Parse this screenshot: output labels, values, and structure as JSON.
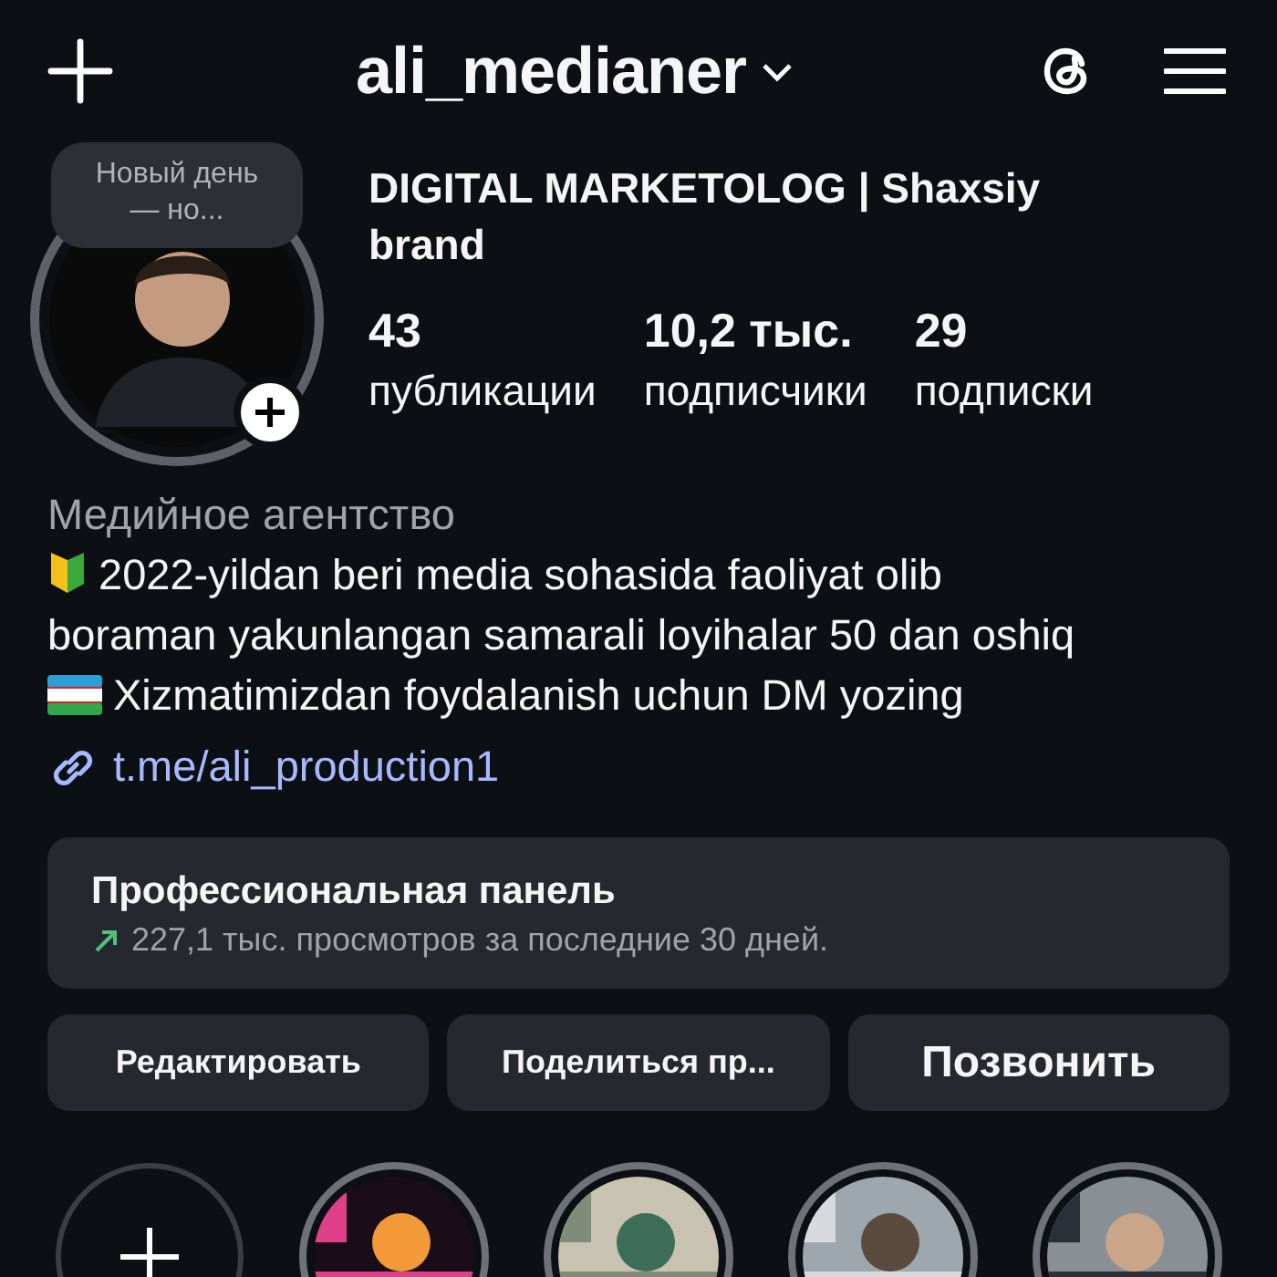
{
  "header": {
    "username": "ali_medianer"
  },
  "note": {
    "text": "Новый день — но..."
  },
  "profile": {
    "name": "DIGITAL MARKETOLOG | Shaxsiy brand"
  },
  "stats": [
    {
      "count": "43",
      "label": "публикации"
    },
    {
      "count": "10,2 тыс.",
      "label": "подписчики"
    },
    {
      "count": "29",
      "label": "подписки"
    }
  ],
  "bio": {
    "category": "Медийное агентство",
    "lines": [
      {
        "kind": "beginner",
        "text": "2022-yildan beri media sohasida faoliyat olib"
      },
      {
        "kind": "plain",
        "text": "boraman yakunlangan samarali loyihalar 50 dan oshiq"
      },
      {
        "kind": "flag",
        "text": "Xizmatimizdan foydalanish uchun DM yozing"
      }
    ],
    "link": "t.me/ali_production1"
  },
  "dashboard": {
    "title": "Профессиональная панель",
    "subtitle": "227,1 тыс. просмотров за последние 30 дней."
  },
  "buttons": [
    {
      "label": "Редактировать",
      "kind": "small"
    },
    {
      "label": "Поделиться пр...",
      "kind": "small"
    },
    {
      "label": "Позвонить",
      "kind": "large"
    }
  ],
  "highlights": [
    {
      "kind": "new"
    },
    {
      "kind": "picture"
    },
    {
      "kind": "picture"
    },
    {
      "kind": "picture"
    },
    {
      "kind": "picture"
    }
  ]
}
